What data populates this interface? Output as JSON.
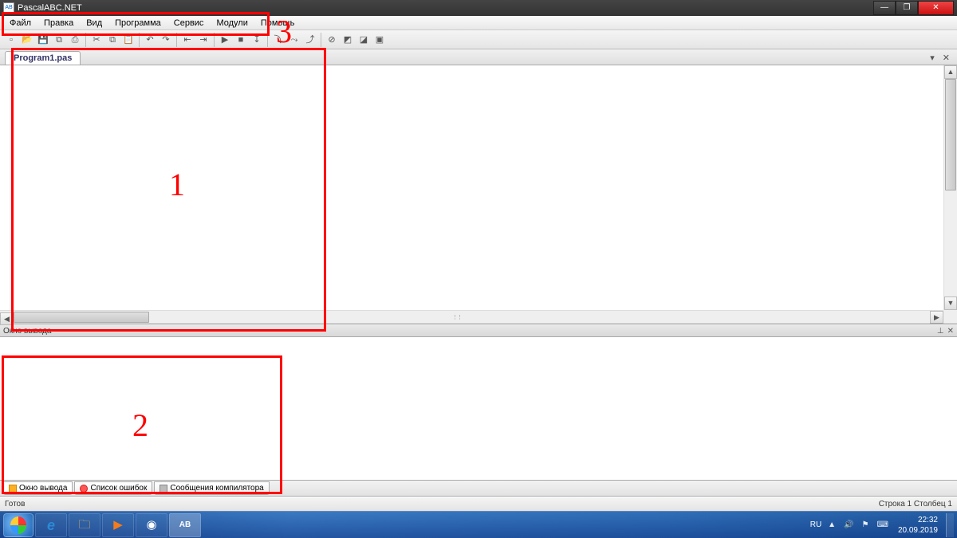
{
  "title": "PascalABC.NET",
  "win_min": "—",
  "win_max": "❐",
  "win_close": "✕",
  "menu": [
    "Файл",
    "Правка",
    "Вид",
    "Программа",
    "Сервис",
    "Модули",
    "Помощь"
  ],
  "toolbar": [
    {
      "n": "new",
      "g": "▫"
    },
    {
      "n": "open",
      "g": "📂"
    },
    {
      "n": "save",
      "g": "💾"
    },
    {
      "n": "saveall",
      "g": "⧉"
    },
    {
      "n": "print",
      "g": "⎙"
    },
    {
      "sep": true
    },
    {
      "n": "cut",
      "g": "✂"
    },
    {
      "n": "copy",
      "g": "⧉"
    },
    {
      "n": "paste",
      "g": "📋"
    },
    {
      "sep": true
    },
    {
      "n": "undo",
      "g": "↶"
    },
    {
      "n": "redo",
      "g": "↷"
    },
    {
      "sep": true
    },
    {
      "n": "nav-back",
      "g": "⇤"
    },
    {
      "n": "nav-fwd",
      "g": "⇥"
    },
    {
      "sep": true
    },
    {
      "n": "run",
      "g": "▶"
    },
    {
      "n": "stop",
      "g": "■"
    },
    {
      "n": "step",
      "g": "↧"
    },
    {
      "sep": true
    },
    {
      "n": "step-into",
      "g": "⤵"
    },
    {
      "n": "step-over",
      "g": "⤳"
    },
    {
      "n": "step-out",
      "g": "⤴"
    },
    {
      "sep": true
    },
    {
      "n": "break",
      "g": "⊘"
    },
    {
      "n": "watch1",
      "g": "◩"
    },
    {
      "n": "watch2",
      "g": "◪"
    },
    {
      "n": "watch3",
      "g": "▣"
    }
  ],
  "tab": {
    "label": "Program1.pas",
    "dropdown": "▾",
    "close": "✕"
  },
  "output_header": {
    "title": "Окно вывода",
    "pin": "⊥",
    "close": "✕"
  },
  "bottom_tabs": [
    {
      "n": "output",
      "label": "Окно вывода",
      "active": true,
      "ico": "ico-out"
    },
    {
      "n": "errors",
      "label": "Список ошибок",
      "active": false,
      "ico": "ico-err"
    },
    {
      "n": "messages",
      "label": "Сообщения компилятора",
      "active": false,
      "ico": "ico-msg"
    }
  ],
  "status": {
    "left": "Готов",
    "right": "Строка 1 Столбец 1"
  },
  "taskbar": {
    "apps": [
      {
        "n": "ie",
        "g": "e",
        "c": "#2a8ad4"
      },
      {
        "n": "explorer",
        "g": "🗀",
        "c": "#f5c04a"
      },
      {
        "n": "media",
        "g": "▶",
        "c": "#f57c1a"
      },
      {
        "n": "chrome",
        "g": "◉",
        "c": "#ffffff"
      },
      {
        "n": "pascalabc",
        "g": "AB",
        "c": "#ffffff"
      }
    ],
    "lang": "RU",
    "tray": [
      "▲",
      "🔊",
      "⚑",
      "⌨"
    ],
    "time": "22:32",
    "date": "20.09.2019"
  },
  "annotations": {
    "a1": "1",
    "a2": "2",
    "a3": "3"
  }
}
